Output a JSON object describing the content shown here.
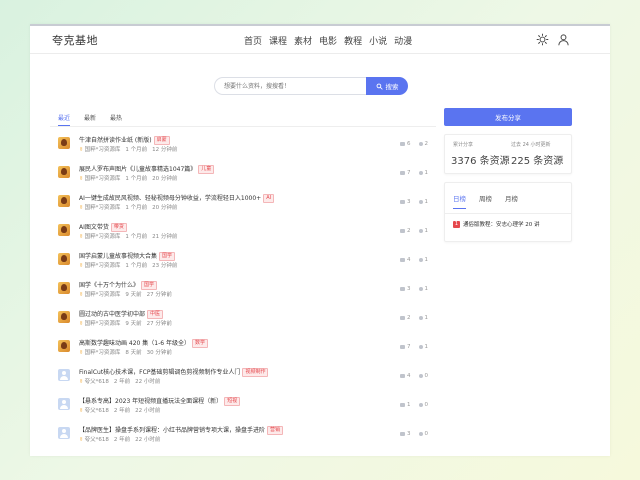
{
  "header": {
    "logo": "夸克基地",
    "nav": [
      "首页",
      "课程",
      "素材",
      "电影",
      "教程",
      "小说",
      "动漫"
    ]
  },
  "search": {
    "placeholder": "想要什么资料，搜搜看！",
    "button_label": "搜索"
  },
  "tabs": [
    "最近",
    "最新",
    "最热"
  ],
  "items": [
    {
      "title": "牛津自然拼读作业纸 (新版)",
      "tag": "启蒙",
      "author": "国粹*习资源库",
      "time": "1 个月前",
      "read": "12 分钟前",
      "views": "6",
      "comments": "2",
      "avatar": "fire"
    },
    {
      "title": "展民人罗布声图片《儿童故事精选1047篇》",
      "tag": "儿童",
      "author": "国粹*习资源库",
      "time": "1 个月前",
      "read": "20 分钟前",
      "views": "7",
      "comments": "1",
      "avatar": "fire"
    },
    {
      "title": "AI一键生成故民风视频、轻秘视频母分钟收益，学流程轻日入1000+",
      "tag": "AI",
      "author": "国粹*习资源库",
      "time": "1 个月前",
      "read": "20 分钟前",
      "views": "3",
      "comments": "1",
      "avatar": "fire"
    },
    {
      "title": "AI图文带货",
      "tag": "带货",
      "author": "国粹*习资源库",
      "time": "1 个月前",
      "read": "21 分钟前",
      "views": "2",
      "comments": "1",
      "avatar": "fire"
    },
    {
      "title": "国学启蒙儿童故事视频大合集",
      "tag": "国学",
      "author": "国粹*习资源库",
      "time": "1 个月前",
      "read": "23 分钟前",
      "views": "4",
      "comments": "1",
      "avatar": "fire"
    },
    {
      "title": "国学《十万个为什么》",
      "tag": "国学",
      "author": "国粹*习资源库",
      "time": "9 天前",
      "read": "27 分钟前",
      "views": "3",
      "comments": "1",
      "avatar": "fire"
    },
    {
      "title": "圆过动的古中医学初中部",
      "tag": "中医",
      "author": "国粹*习资源库",
      "time": "9 天前",
      "read": "27 分钟前",
      "views": "2",
      "comments": "1",
      "avatar": "fire"
    },
    {
      "title": "高斯数学趣味动画 420 集（1-6 年级全）",
      "tag": "数学",
      "author": "国粹*习资源库",
      "time": "8 天前",
      "read": "30 分钟前",
      "views": "7",
      "comments": "1",
      "avatar": "fire"
    },
    {
      "title": "FinalCut核心技术课，FCP基础剪辑调色剪视频制作专业人门",
      "tag": "视频制作",
      "author": "夸父*618",
      "time": "2 年前",
      "read": "22 小时前",
      "views": "4",
      "comments": "0",
      "avatar": "user"
    },
    {
      "title": "【悬系专高】2023 年短视频直播玩法全面课程（新）",
      "tag": "短视",
      "author": "夸父*618",
      "time": "2 年前",
      "read": "22 小时前",
      "views": "1",
      "comments": "0",
      "avatar": "user"
    },
    {
      "title": "【品牌医生】操盘手系列课程：小红书品牌营销专项大课，操盘手进阶",
      "tag": "营销",
      "author": "夸父*618",
      "time": "2 年前",
      "read": "22 小时前",
      "views": "3",
      "comments": "0",
      "avatar": "user"
    }
  ],
  "sidebar": {
    "share_button": "发布分享",
    "stats": [
      {
        "label": "累计分享",
        "value": "3376 条资源"
      },
      {
        "label": "过去 24 小时更新",
        "value": "225 条资源"
      }
    ],
    "rank_tabs": [
      "日榜",
      "周榜",
      "月榜"
    ],
    "rank_items": [
      {
        "rank": "1",
        "title": "通俗版教程：安志心理学 20 讲"
      }
    ]
  }
}
